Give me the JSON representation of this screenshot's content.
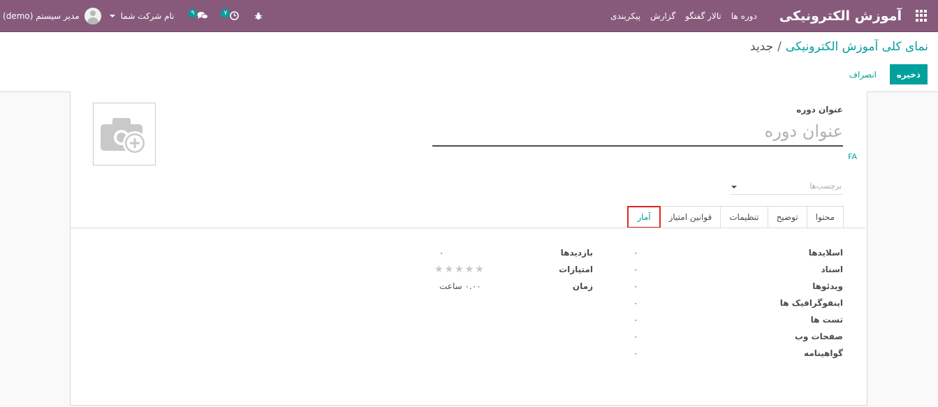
{
  "navbar": {
    "app_name": "آموزش الکترونیکی",
    "menu": [
      "دوره ها",
      "تالار گفتگو",
      "گزارش",
      "پیکربندی"
    ],
    "activity_count": "۷",
    "messages_count": "۹",
    "company": "نام شرکت شما",
    "user": "مدیر سیستم (demo)"
  },
  "breadcrumb": {
    "parent": "نمای کلی آموزش الکترونیکی",
    "separator": "/",
    "current": "جدید"
  },
  "buttons": {
    "save": "ذخیره",
    "discard": "انصراف"
  },
  "form": {
    "title_label": "عنوان دوره",
    "title_placeholder": "عنوان دوره",
    "lang": "FA",
    "tags_placeholder": "برچسب‌ها"
  },
  "tabs": [
    "محتوا",
    "توضیح",
    "تنظیمات",
    "قوانین امتیاز",
    "آمار"
  ],
  "stats_left": [
    {
      "label": "اسلایدها",
      "value": "۰"
    },
    {
      "label": "اسناد",
      "value": "۰"
    },
    {
      "label": "ویدئوها",
      "value": "۰"
    },
    {
      "label": "اینفوگرافیک ها",
      "value": "۰"
    },
    {
      "label": "تست ها",
      "value": "۰"
    },
    {
      "label": "صفحات وب",
      "value": "۰"
    },
    {
      "label": "گواهینامه",
      "value": "۰"
    }
  ],
  "stats_right": {
    "views_label": "بازدیدها",
    "views_value": "۰",
    "rating_label": "امتیازات",
    "rating_value": 0,
    "rating_max": 5,
    "time_label": "زمان",
    "time_value": "۰.۰۰ ساعت"
  },
  "colors": {
    "brand": "#875a7b",
    "accent": "#00a09d",
    "highlight": "#e02424"
  }
}
